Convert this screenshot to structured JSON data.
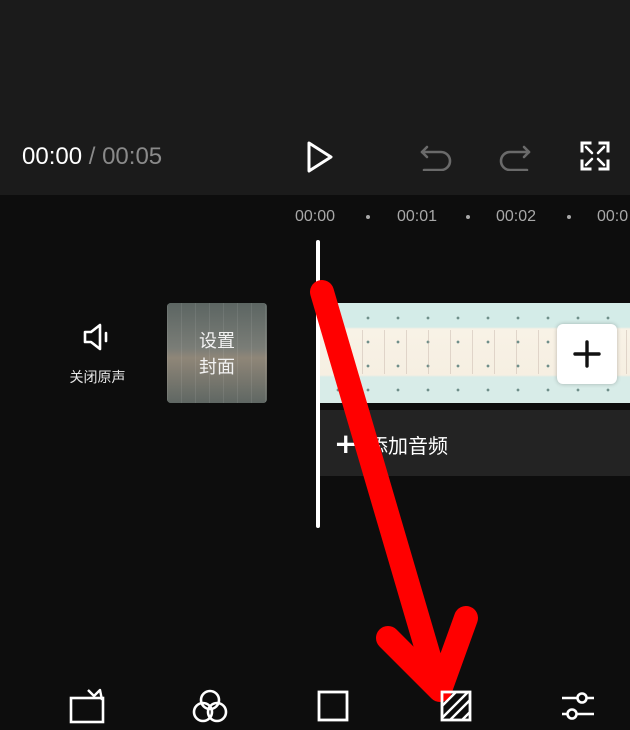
{
  "player": {
    "current_time": "00:00",
    "separator": " / ",
    "total_time": "00:05"
  },
  "ruler": {
    "ticks": [
      "00:00",
      "00:01",
      "00:02",
      "00:0"
    ]
  },
  "track_header": {
    "mute_label": "关闭原声",
    "cover_label_line1": "设置",
    "cover_label_line2": "封面"
  },
  "audio_track": {
    "add_label": "添加音频"
  },
  "toolbar": {
    "icons": [
      "canvas-icon",
      "filter-icon",
      "ratio-icon",
      "background-icon",
      "adjust-icon"
    ]
  },
  "colors": {
    "background": "#0d0d0d",
    "preview_bar": "#1b1b1b",
    "annotation_arrow": "#ff0000",
    "track_bg": "#232323"
  }
}
